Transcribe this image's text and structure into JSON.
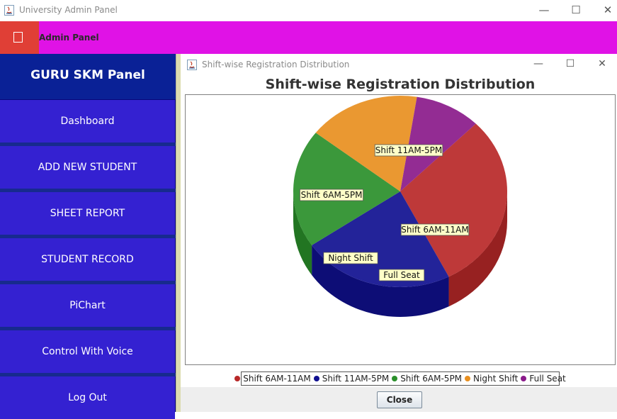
{
  "window": {
    "title": "University Admin Panel",
    "controls": {
      "minimize": "—",
      "maximize": "☐",
      "close": "✕"
    }
  },
  "header": {
    "title": "Admin Panel",
    "color": "#e012e6"
  },
  "sidebar": {
    "title": "GURU SKM Panel",
    "items": [
      {
        "label": "Dashboard"
      },
      {
        "label": "ADD NEW STUDENT"
      },
      {
        "label": "SHEET REPORT"
      },
      {
        "label": "STUDENT RECORD"
      },
      {
        "label": "PiChart"
      },
      {
        "label": "Control With Voice"
      },
      {
        "label": "Log Out"
      }
    ]
  },
  "internal_frame": {
    "title": "Shift-wise Registration Distribution",
    "close_button": "Close"
  },
  "chart_data": {
    "type": "pie",
    "title": "Shift-wise Registration Distribution",
    "three_d": true,
    "legend_position": "bottom",
    "series": [
      {
        "name": "Shift 6AM-11AM",
        "value": 30,
        "color": "#b82828"
      },
      {
        "name": "Shift 11AM-5PM",
        "value": 23,
        "color": "#101090"
      },
      {
        "name": "Shift 6AM-5PM",
        "value": 20,
        "color": "#2a8f2a"
      },
      {
        "name": "Night Shift",
        "value": 17,
        "color": "#e88f1f"
      },
      {
        "name": "Full Seat",
        "value": 10,
        "color": "#8a1a8a"
      }
    ]
  }
}
